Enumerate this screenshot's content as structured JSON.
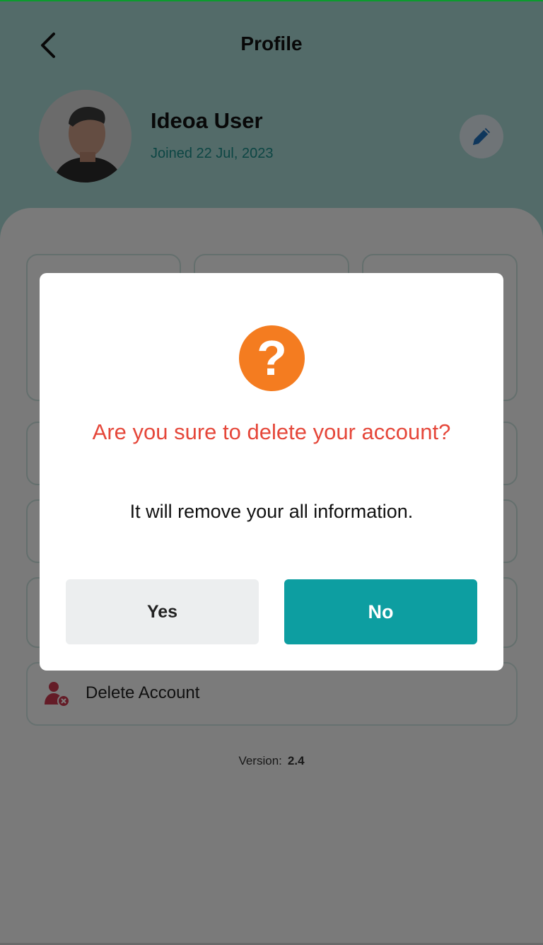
{
  "header": {
    "title": "Profile",
    "back_icon": "chevron-left-icon"
  },
  "profile": {
    "name": "Ideoa User",
    "joined": "Joined 22 Jul, 2023",
    "edit_icon": "pencil-icon"
  },
  "menu": {
    "delete_account_label": "Delete Account",
    "delete_icon": "user-remove-icon"
  },
  "footer": {
    "version_label": "Version:",
    "version_value": "2.4"
  },
  "dialog": {
    "icon": "question-icon",
    "icon_glyph": "?",
    "title": "Are you sure to delete your account?",
    "message": "It will remove your all information.",
    "yes_label": "Yes",
    "no_label": "No"
  },
  "colors": {
    "accent": "#0d9ea1",
    "warning_icon": "#f47c20",
    "danger_text": "#e5473a",
    "joined_text": "#1a8c88"
  }
}
